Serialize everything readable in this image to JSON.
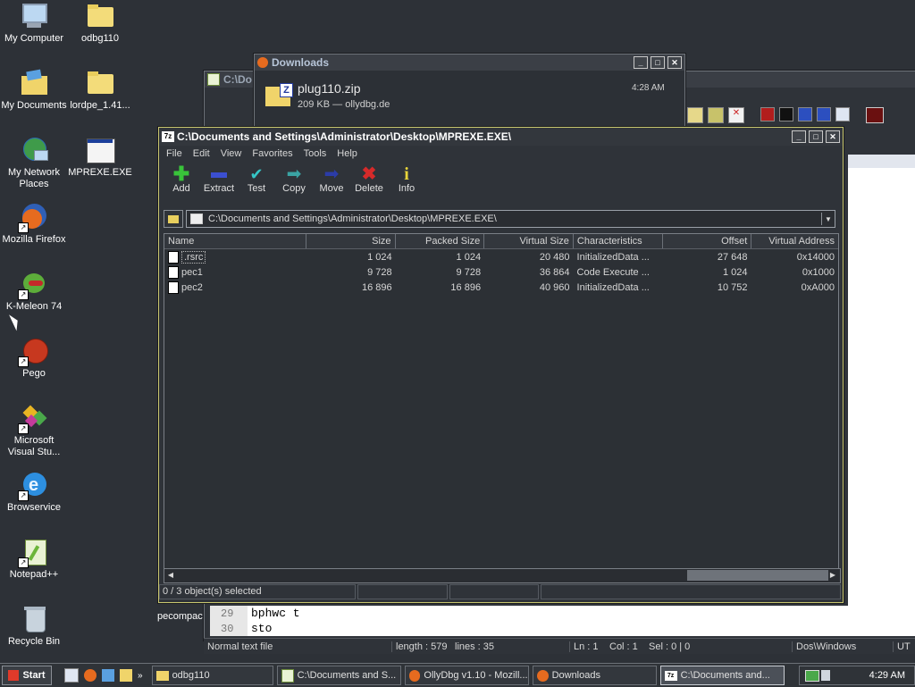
{
  "desktop": {
    "icons": [
      {
        "label": "My Computer"
      },
      {
        "label": "odbg110"
      },
      {
        "label": "My Documents"
      },
      {
        "label": "lordpe_1.41..."
      },
      {
        "label": "My Network Places"
      },
      {
        "label": "MPREXE.EXE"
      },
      {
        "label": "Mozilla Firefox"
      },
      {
        "label": "K-Meleon 74"
      },
      {
        "label": "Pego"
      },
      {
        "label": "Microsoft Visual Stu..."
      },
      {
        "label": "Browservice"
      },
      {
        "label": "Notepad++"
      },
      {
        "label": "Recycle Bin"
      },
      {
        "label": "pecompact"
      }
    ]
  },
  "downloads": {
    "title": "Downloads",
    "file": "plug110.zip",
    "meta": "209 KB — ollydbg.de",
    "time": "4:28 AM"
  },
  "editor": {
    "title_partial": "C:\\Do",
    "lines": [
      {
        "num": "29",
        "text": "bphwc t"
      },
      {
        "num": "30",
        "text": "sto"
      }
    ],
    "status": {
      "type": "Normal text file",
      "length": "length : 579",
      "lines": "lines : 35",
      "ln": "Ln : 1",
      "col": "Col : 1",
      "sel": "Sel : 0 | 0",
      "eol": "Dos\\Windows",
      "enc": "UT"
    }
  },
  "sevenzip": {
    "title": "C:\\Documents and Settings\\Administrator\\Desktop\\MPREXE.EXE\\",
    "menu": [
      "File",
      "Edit",
      "View",
      "Favorites",
      "Tools",
      "Help"
    ],
    "toolbar": [
      {
        "label": "Add",
        "icon": "plus-icon",
        "color": "#39c43a"
      },
      {
        "label": "Extract",
        "icon": "minus-icon",
        "color": "#3b4fd0"
      },
      {
        "label": "Test",
        "icon": "check-icon",
        "color": "#35c6c6"
      },
      {
        "label": "Copy",
        "icon": "copy-arrow-icon",
        "color": "#3aa3a3"
      },
      {
        "label": "Move",
        "icon": "move-arrow-icon",
        "color": "#2b3ca8"
      },
      {
        "label": "Delete",
        "icon": "delete-x-icon",
        "color": "#d62a2a"
      },
      {
        "label": "Info",
        "icon": "info-icon",
        "color": "#e7d43a"
      }
    ],
    "address": "C:\\Documents and Settings\\Administrator\\Desktop\\MPREXE.EXE\\",
    "columns": [
      "Name",
      "Size",
      "Packed Size",
      "Virtual Size",
      "Characteristics",
      "Offset",
      "Virtual Address"
    ],
    "rows": [
      {
        "name": ".rsrc",
        "size": "1 024",
        "packed": "1 024",
        "vsize": "20 480",
        "chars": "InitializedData ...",
        "offset": "27 648",
        "vaddr": "0x14000"
      },
      {
        "name": "pec1",
        "size": "9 728",
        "packed": "9 728",
        "vsize": "36 864",
        "chars": "Code Execute ...",
        "offset": "1 024",
        "vaddr": "0x1000"
      },
      {
        "name": "pec2",
        "size": "16 896",
        "packed": "16 896",
        "vsize": "40 960",
        "chars": "InitializedData ...",
        "offset": "10 752",
        "vaddr": "0xA000"
      }
    ],
    "status": "0 / 3 object(s) selected"
  },
  "taskbar": {
    "start": "Start",
    "tasks": [
      {
        "label": "odbg110"
      },
      {
        "label": "C:\\Documents and S..."
      },
      {
        "label": "OllyDbg v1.10 - Mozill..."
      },
      {
        "label": "Downloads"
      },
      {
        "label": "C:\\Documents and..."
      }
    ],
    "clock": "4:29 AM"
  }
}
